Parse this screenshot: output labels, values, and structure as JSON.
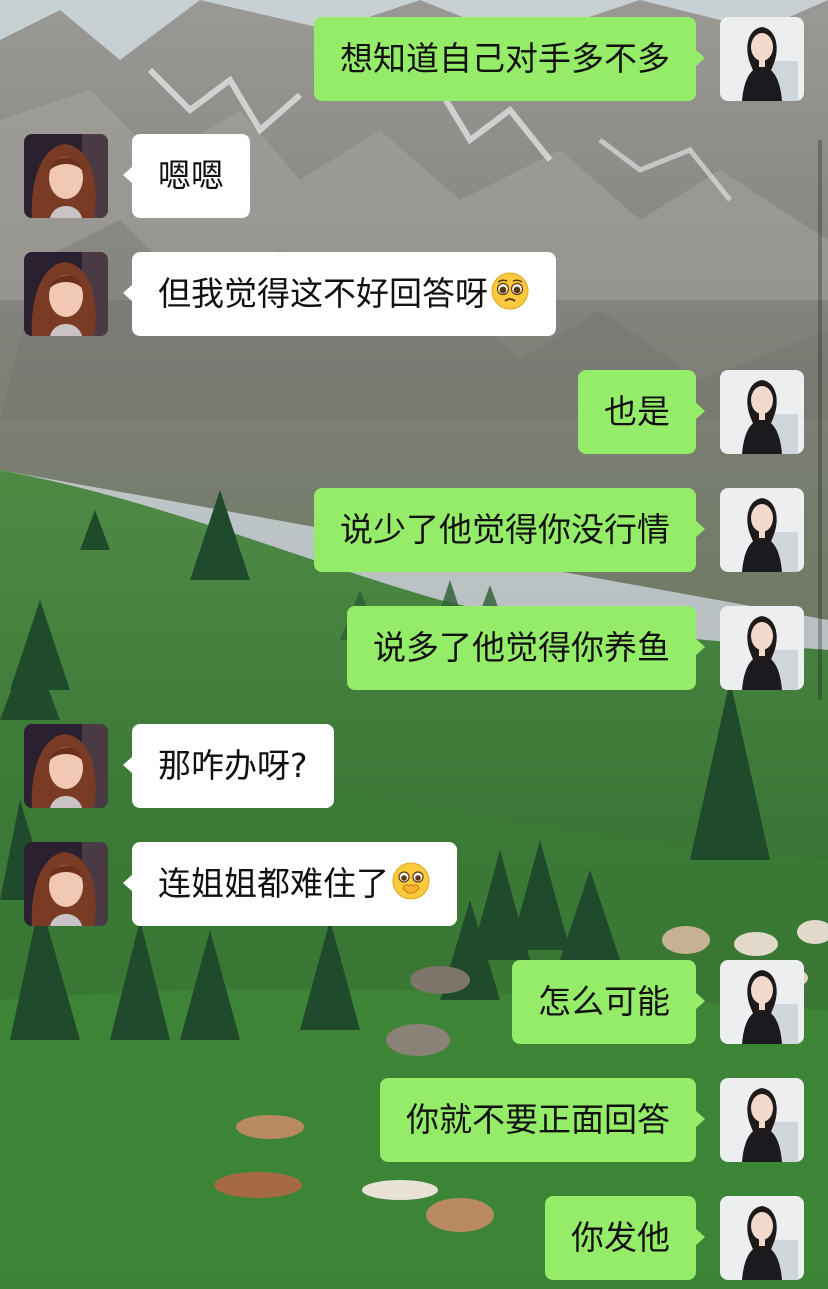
{
  "background": {
    "scene": "mountain-meadow-wallpaper",
    "sky_color": "#b9c3c8",
    "rock_color": "#8d8c88",
    "grass_color": "#3d7a3a",
    "tree_color": "#1f4a2c"
  },
  "colors": {
    "self_bubble": "#95ec69",
    "other_bubble": "#ffffff",
    "text": "#111111"
  },
  "messages": [
    {
      "sender": "self",
      "text": "想知道自己对手多不多",
      "emoji": null
    },
    {
      "sender": "other",
      "text": "嗯嗯",
      "emoji": null
    },
    {
      "sender": "other",
      "text": "但我觉得这不好回答呀",
      "emoji": "pleading-face-emoji"
    },
    {
      "sender": "self",
      "text": "也是",
      "emoji": null
    },
    {
      "sender": "self",
      "text": "说少了他觉得你没行情",
      "emoji": null
    },
    {
      "sender": "self",
      "text": "说多了他觉得你养鱼",
      "emoji": null
    },
    {
      "sender": "other",
      "text": "那咋办呀?",
      "emoji": null
    },
    {
      "sender": "other",
      "text": "连姐姐都难住了",
      "emoji": "face-with-hand-over-mouth-emoji"
    },
    {
      "sender": "self",
      "text": "怎么可能",
      "emoji": null
    },
    {
      "sender": "self",
      "text": "你就不要正面回答",
      "emoji": null
    },
    {
      "sender": "self",
      "text": "你发他",
      "emoji": null
    }
  ]
}
